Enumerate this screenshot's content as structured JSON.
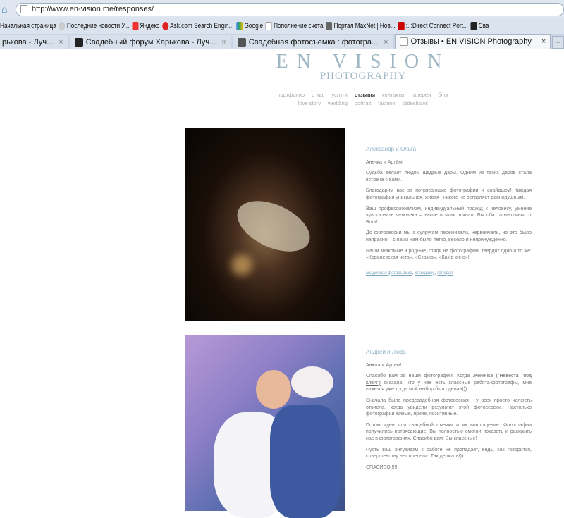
{
  "browser": {
    "url": "http://www.en-vision.me/responses/",
    "bookmarks": [
      "Начальная страница",
      "Последние новости У...",
      "Яндекс",
      "Ask.com Search Engin...",
      "Google",
      "Пополнение счета",
      "Портал MaxNet | Нов...",
      ":.::Direct Connect Port...",
      "Сва"
    ],
    "tabs": [
      {
        "label": "рькова - Луч...",
        "active": false
      },
      {
        "label": "Свадебный форум Харькова - Луч...",
        "active": false
      },
      {
        "label": "Свадебная фотосъемка : фотогра...",
        "active": false
      },
      {
        "label": "Отзывы • EN VISION Photography",
        "active": true
      }
    ],
    "close_glyph": "×",
    "new_tab_glyph": "+"
  },
  "site": {
    "logo_top": "EN VISION",
    "logo_bottom": "PHOTOGRAPHY",
    "nav_row1": [
      "портфолио",
      "о нас",
      "услуги",
      "отзывы",
      "контакты",
      "галерея",
      "блог"
    ],
    "nav_row2": [
      "love story",
      "wedding",
      "portrait",
      "fashion",
      "slideshows"
    ]
  },
  "reviews": [
    {
      "name": "Александр и Ольга",
      "paragraphs": [
        "Анечка и Артём!",
        "Судьба делает людям щедрые дары. Одним из таких даров стала встреча с вами.",
        "Благодарим вас за потрясающие фотографии и слайдшоу! Каждая фотография уникальная, живая - никого не оставляет равнодушным.",
        "Ваш профессионализм, индивидуальный подход к человеку, умение чувствовать человека – выше всяких похвал! Вы оба талантливы от Бога!",
        "До фотосессии мы с супругом переживали, нервничали, но это было напрасно – с вами нам было легко, весело и непринуждённо.",
        "Наши знакомые и родные, глядя на фотографии, твердят одно и то же: «Королевская чета», «Сказка», «Как в кино»!"
      ],
      "links": [
        "свадебная фотосъемка",
        "слайдшоу",
        "галерея"
      ]
    },
    {
      "name": "Андрей и Люба",
      "paragraphs": [
        "Анюта и Артем!",
        "Сначала была предсвадебная фотосессия - у всех просто челюсть отвисла, когда увидели результат этой фотосессии. Настолько фотографии живые, яркие, позитивные.",
        "Потом идеи для свадебной съемки и их воплощение. Фотографии получились потрясающие. Вы полностью смогли показать и раскрыть нас в фотографиях. Спасибо вам! Вы классные!",
        "Пусть ваш энтузиазм к работе не пропадает, ведь, как говорится, совершенству нет предела. Так держать!))",
        "СПАСИБО!!!!!!"
      ],
      "p2_before": "Спасибо вам за наши фотографии! Когда ",
      "p2_link": "Женечка (\"Невеста \"под ключ\")",
      "p2_after": " сказала, что у нее есть классные ребята-фотографы, мне кажется уже тогда мой выбор был сделан)))"
    }
  ]
}
